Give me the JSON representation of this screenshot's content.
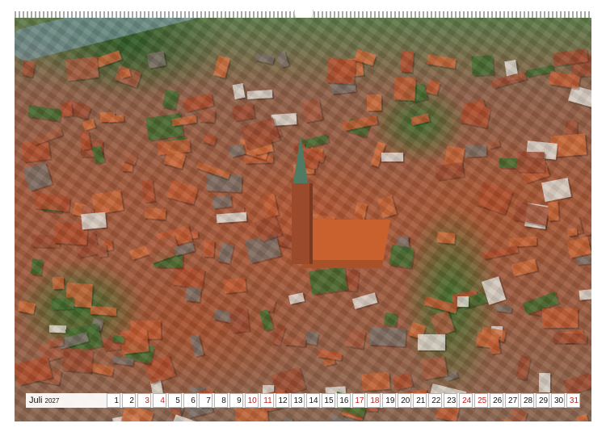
{
  "calendar": {
    "month": "Juli",
    "year": "2027",
    "days": [
      "1",
      "2",
      "3",
      "4",
      "5",
      "6",
      "7",
      "8",
      "9",
      "10",
      "11",
      "12",
      "13",
      "14",
      "15",
      "16",
      "17",
      "18",
      "19",
      "20",
      "21",
      "22",
      "23",
      "24",
      "25",
      "26",
      "27",
      "28",
      "29",
      "30",
      "31"
    ],
    "red_days": [
      3,
      4,
      10,
      11,
      17,
      18,
      24,
      25,
      31
    ],
    "red_color": "#c81a1a"
  },
  "photo": {
    "roof_color": "#b5542e",
    "tree_color": "#3e6d2a",
    "spire_color": "#4f7a63"
  }
}
